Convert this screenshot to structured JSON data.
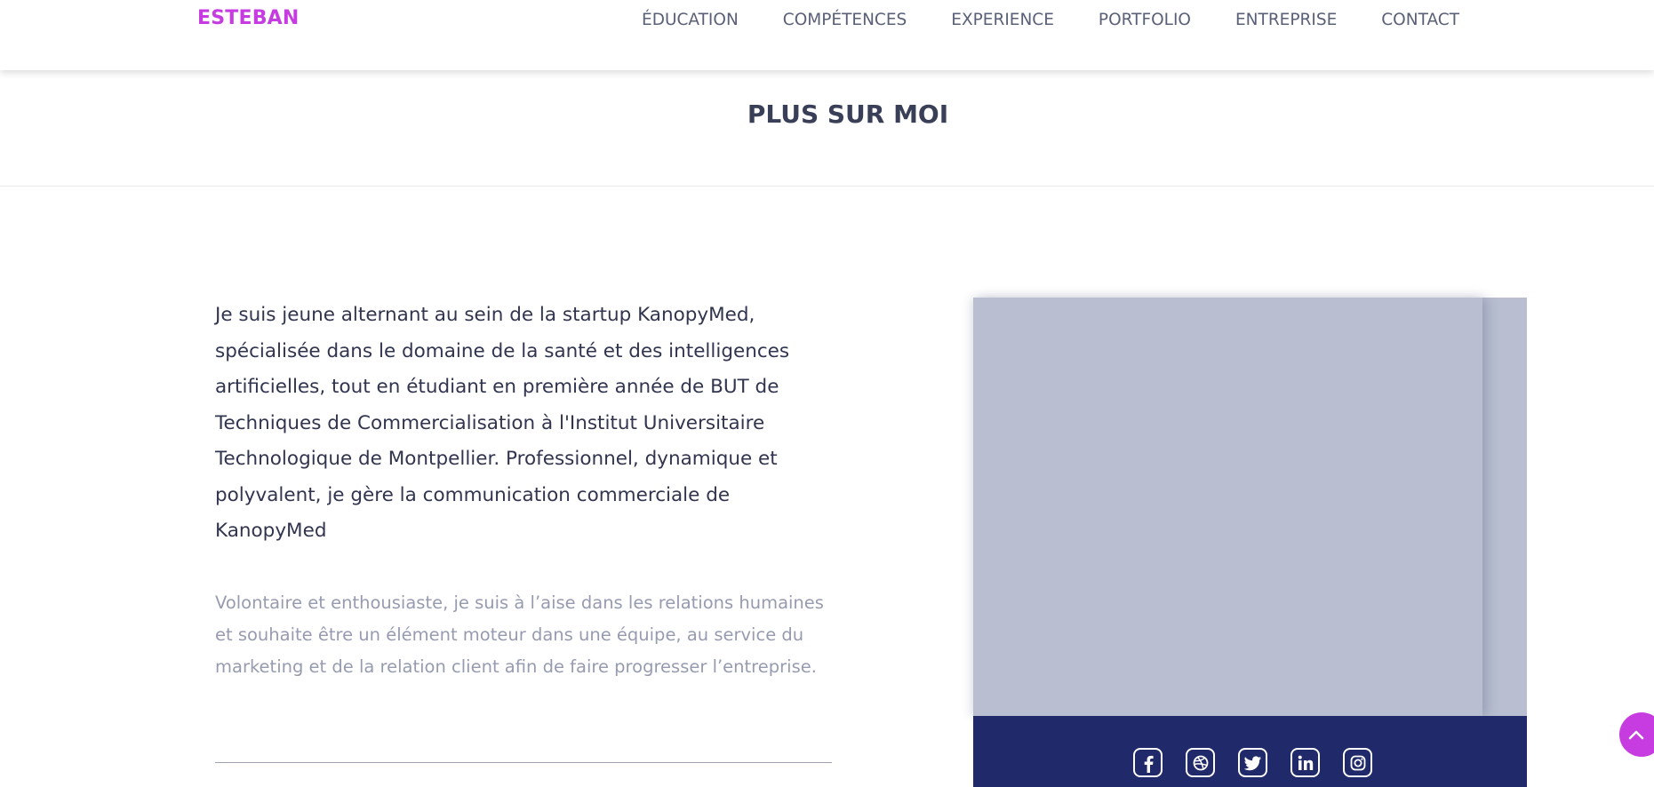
{
  "header": {
    "brand": "ESTEBAN",
    "nav": [
      {
        "label": "ÉDUCATION"
      },
      {
        "label": "COMPÉTENCES"
      },
      {
        "label": "EXPERIENCE"
      },
      {
        "label": "PORTFOLIO"
      },
      {
        "label": "ENTREPRISE"
      },
      {
        "label": "CONTACT"
      }
    ]
  },
  "section": {
    "title": "PLUS SUR MOI"
  },
  "about": {
    "intro": "Je suis jeune alternant au sein de la startup KanopyMed, spécialisée dans le domaine de la santé et des intelligences artificielles, tout en étudiant en première année de BUT de Techniques de Commercialisation à l'Institut Universitaire Technologique de Montpellier. Professionnel, dynamique et polyvalent, je gère la communication commerciale de KanopyMed",
    "details": "Volontaire et enthousiaste, je suis à l’aise dans les relations humaines et souhaite être un élément moteur dans une équipe, au service du marketing et de la relation client afin de faire progresser l’entreprise."
  },
  "social": {
    "icons": [
      "facebook-icon",
      "dribbble-icon",
      "twitter-icon",
      "linkedin-icon",
      "instagram-icon"
    ]
  },
  "colors": {
    "brand": "#c63ce0",
    "card": "#b9bfd1",
    "social_bar": "#20296a",
    "heading": "#3a3f58",
    "muted_text": "#979bb0"
  }
}
